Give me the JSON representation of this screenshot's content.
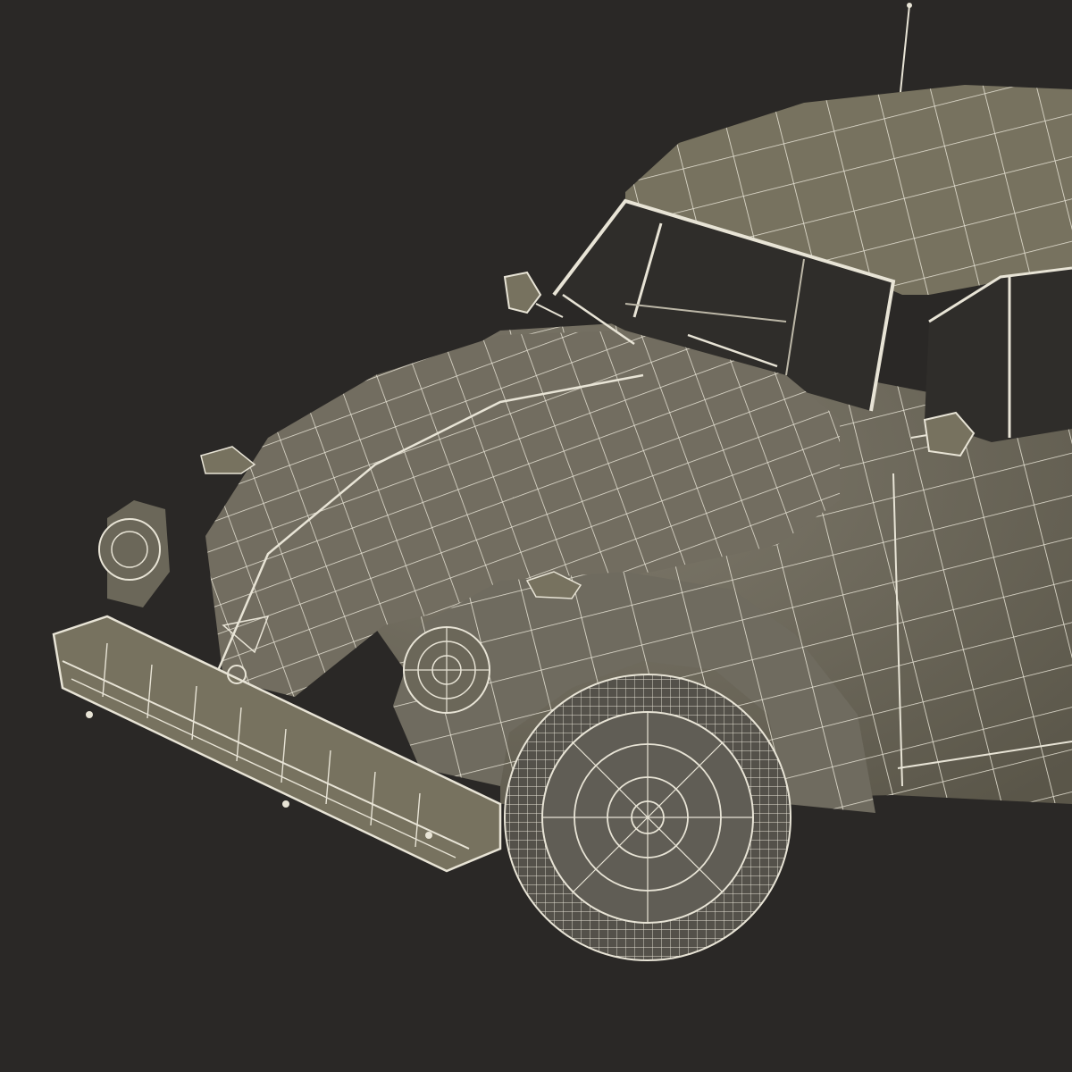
{
  "scene": {
    "subject": "wireframe-car-render",
    "colors": {
      "background": "#2a2826",
      "body": "#6f6b5f",
      "body_shadow": "#5a5649",
      "body_light": "#807b6d",
      "wire": "#e8e4d6",
      "wire_dim": "#bdb8a8",
      "glass": "#2a2826",
      "tire": "#54514a"
    }
  }
}
